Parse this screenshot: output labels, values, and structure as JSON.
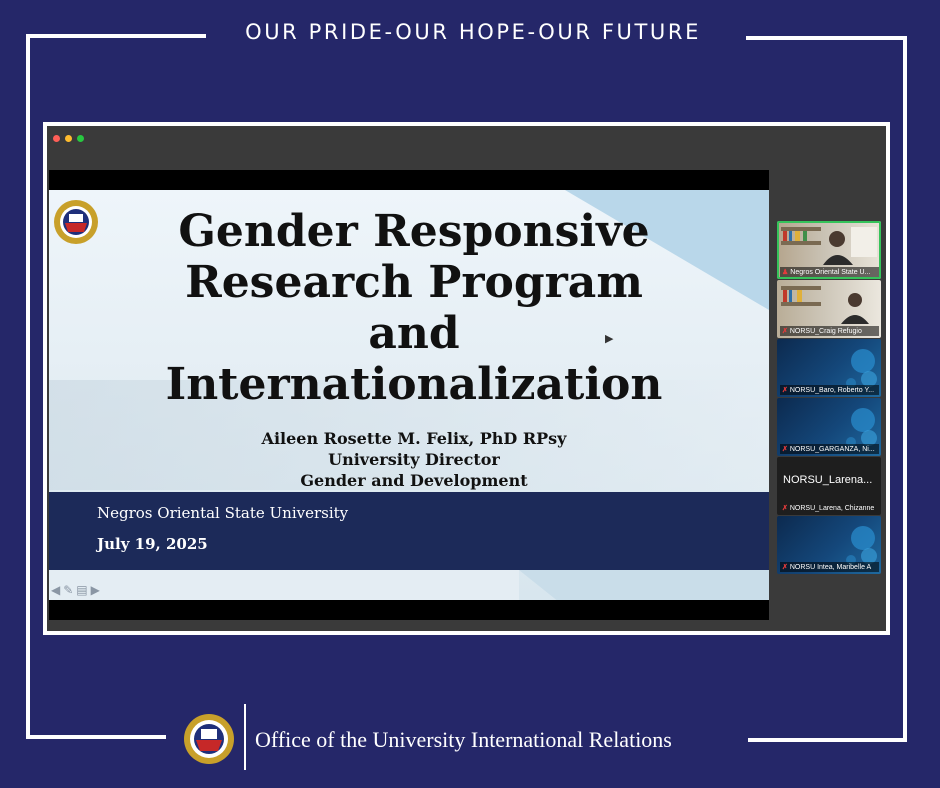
{
  "tagline": "OUR PRIDE-OUR HOPE-OUR FUTURE",
  "colors": {
    "background": "#252769",
    "slide_band": "#1c2a59",
    "active_speaker": "#35c35a",
    "mic_muted": "#e33b3b"
  },
  "slide": {
    "title_lines": [
      "Gender Responsive",
      "Research Program",
      "and",
      "Internationalization"
    ],
    "presenter_name": "Aileen Rosette M. Felix, PhD RPsy",
    "presenter_role": "University Director",
    "presenter_unit": "Gender and Development",
    "university": "Negros Oriental State University",
    "date": "July 19, 2025",
    "toolbar_icons": [
      "arrow-left-icon",
      "pen-icon",
      "slides-icon",
      "arrow-right-icon"
    ]
  },
  "participants": [
    {
      "name": "Negros Oriental State U...",
      "type": "camera",
      "active": true
    },
    {
      "name": "NORSU_Craig Refugio",
      "type": "camera",
      "active": false
    },
    {
      "name": "NORSU_Baro, Roberto Y...",
      "type": "poster",
      "active": false
    },
    {
      "name": "NORSU_GARGANZA, Ni...",
      "type": "poster",
      "active": false
    },
    {
      "name": "NORSU_Larena, Chizanne",
      "type": "name",
      "display_name": "NORSU_Larena...",
      "active": false
    },
    {
      "name": "NORSU Intea, Maribelle A",
      "type": "poster",
      "active": false
    }
  ],
  "footer": {
    "office": "Office of the University International Relations"
  }
}
